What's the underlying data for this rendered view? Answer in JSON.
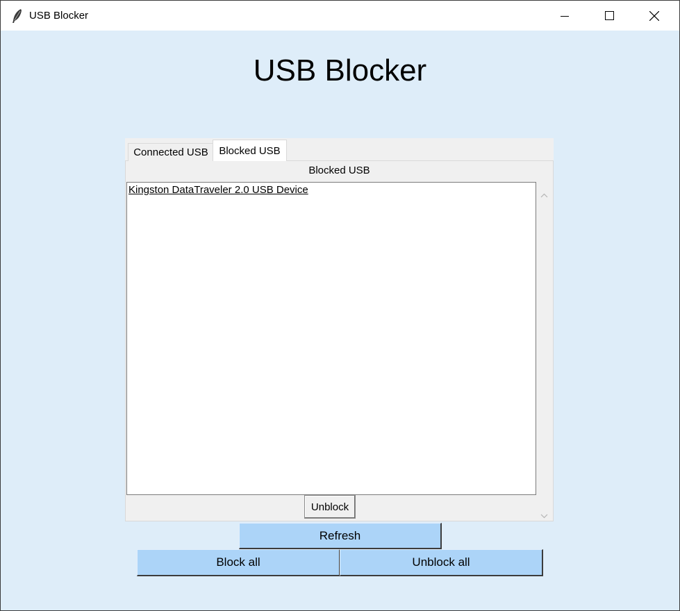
{
  "window": {
    "title": "USB Blocker",
    "icon": "feather-icon",
    "controls": {
      "minimize": "minimize-icon",
      "maximize": "maximize-icon",
      "close": "close-icon"
    }
  },
  "app": {
    "heading": "USB Blocker"
  },
  "tabs": [
    {
      "label": "Connected USB",
      "selected": false
    },
    {
      "label": "Blocked USB",
      "selected": true
    }
  ],
  "blocked_pane": {
    "label": "Blocked USB",
    "items": [
      "Kingston DataTraveler 2.0 USB Device"
    ],
    "unblock_label": "Unblock"
  },
  "actions": {
    "refresh_label": "Refresh",
    "block_all_label": "Block all",
    "unblock_all_label": "Unblock all"
  },
  "colors": {
    "window_bg": "#deedf9",
    "button_bg": "#acd4f8",
    "panel_bg": "#f0f0f0"
  }
}
